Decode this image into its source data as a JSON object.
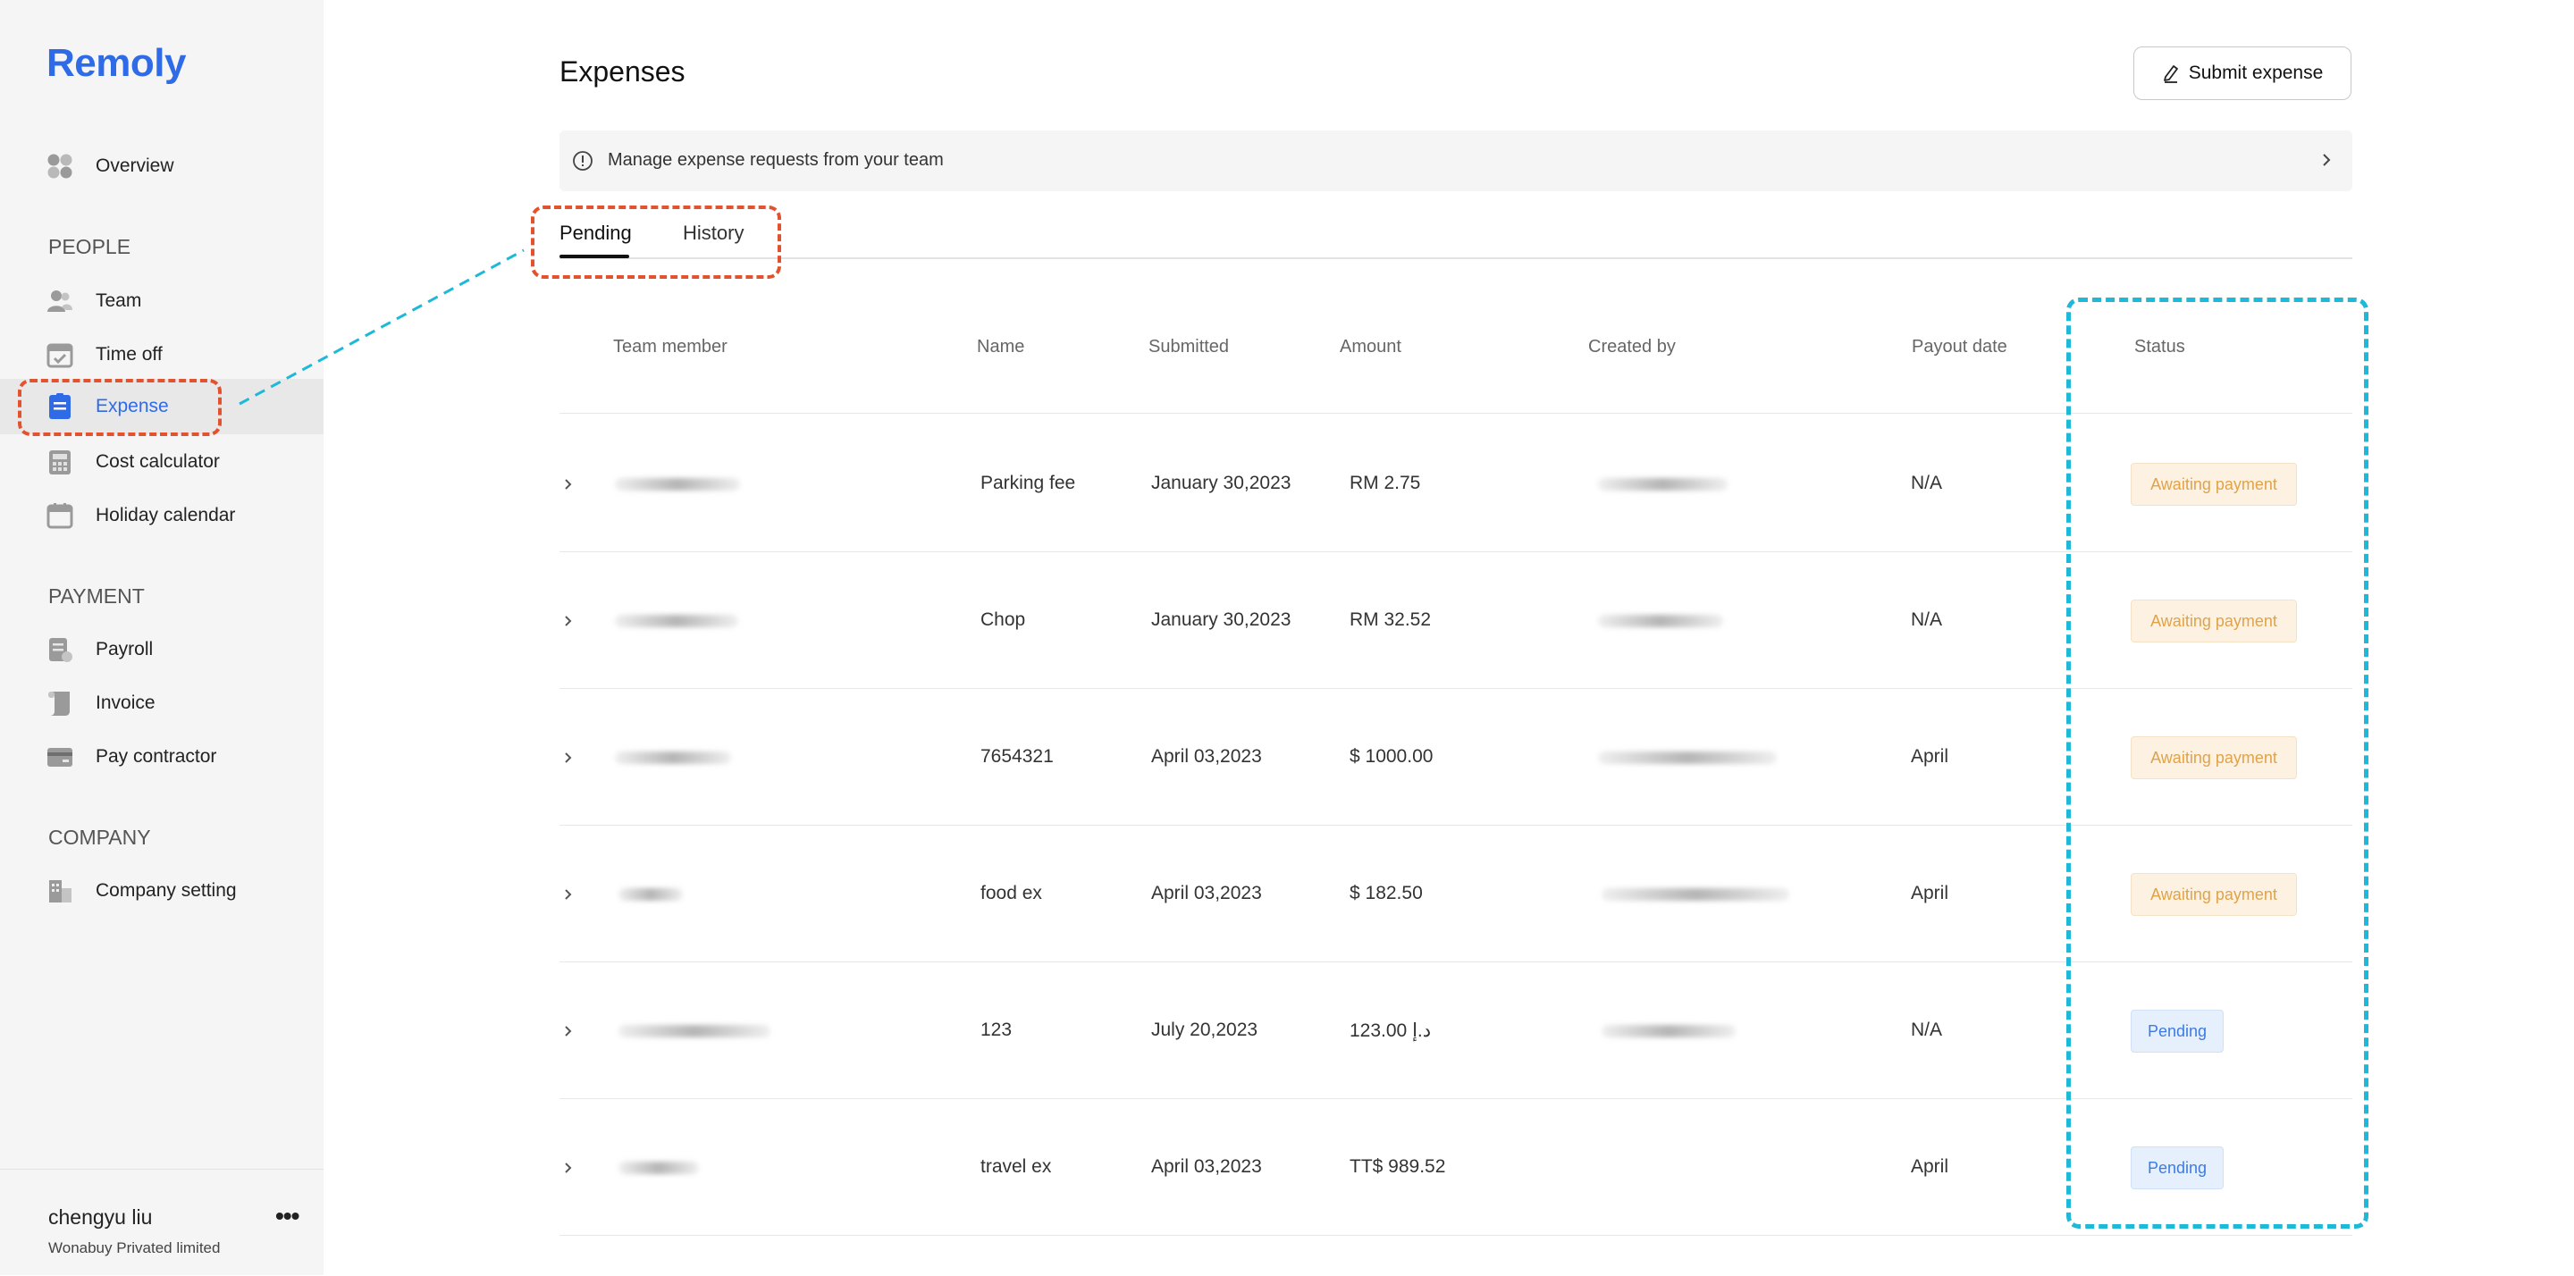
{
  "app": {
    "logo": "Remoly"
  },
  "sidebar": {
    "overview": "Overview",
    "sections": {
      "people": "PEOPLE",
      "payment": "PAYMENT",
      "company": "COMPANY"
    },
    "items": {
      "team": "Team",
      "time_off": "Time off",
      "expense": "Expense",
      "cost_calculator": "Cost calculator",
      "holiday_calendar": "Holiday calendar",
      "payroll": "Payroll",
      "invoice": "Invoice",
      "pay_contractor": "Pay contractor",
      "company_setting": "Company setting"
    },
    "active_item": "Expense",
    "user": {
      "name": "chengyu liu",
      "org": "Wonabuy Privated limited",
      "menu": "•••"
    }
  },
  "main": {
    "title": "Expenses",
    "submit_button": "Submit expense",
    "info_text": "Manage expense requests from your team",
    "tabs": [
      "Pending",
      "History"
    ],
    "active_tab": "Pending",
    "table": {
      "headers": [
        "Team member",
        "Name",
        "Submitted",
        "Amount",
        "Created by",
        "Payout date",
        "Status"
      ],
      "rows": [
        {
          "name": "Parking fee",
          "submitted": "January 30,2023",
          "amount": "RM 2.75",
          "payout": "N/A",
          "status": "Awaiting payment"
        },
        {
          "name": "Chop",
          "submitted": "January 30,2023",
          "amount": "RM 32.52",
          "payout": "N/A",
          "status": "Awaiting payment"
        },
        {
          "name": "7654321",
          "submitted": "April 03,2023",
          "amount": "$ 1000.00",
          "payout": "April",
          "status": "Awaiting payment"
        },
        {
          "name": "food ex",
          "submitted": "April 03,2023",
          "amount": "$ 182.50",
          "payout": "April",
          "status": "Awaiting payment"
        },
        {
          "name": "123",
          "submitted": "July 20,2023",
          "amount": "123.00 د.إ",
          "payout": "N/A",
          "status": "Pending"
        },
        {
          "name": "travel ex",
          "submitted": "April 03,2023",
          "amount": "TT$ 989.52",
          "payout": "April",
          "status": "Pending"
        }
      ]
    }
  },
  "colors": {
    "brand": "#2f6be6",
    "awaiting_text": "#e0a24a",
    "awaiting_bg": "#fdf2e2",
    "pending_text": "#3d7be0",
    "pending_bg": "#e6f0fc",
    "annotation_red": "#e2522f",
    "annotation_cyan": "#1eb8d8"
  }
}
